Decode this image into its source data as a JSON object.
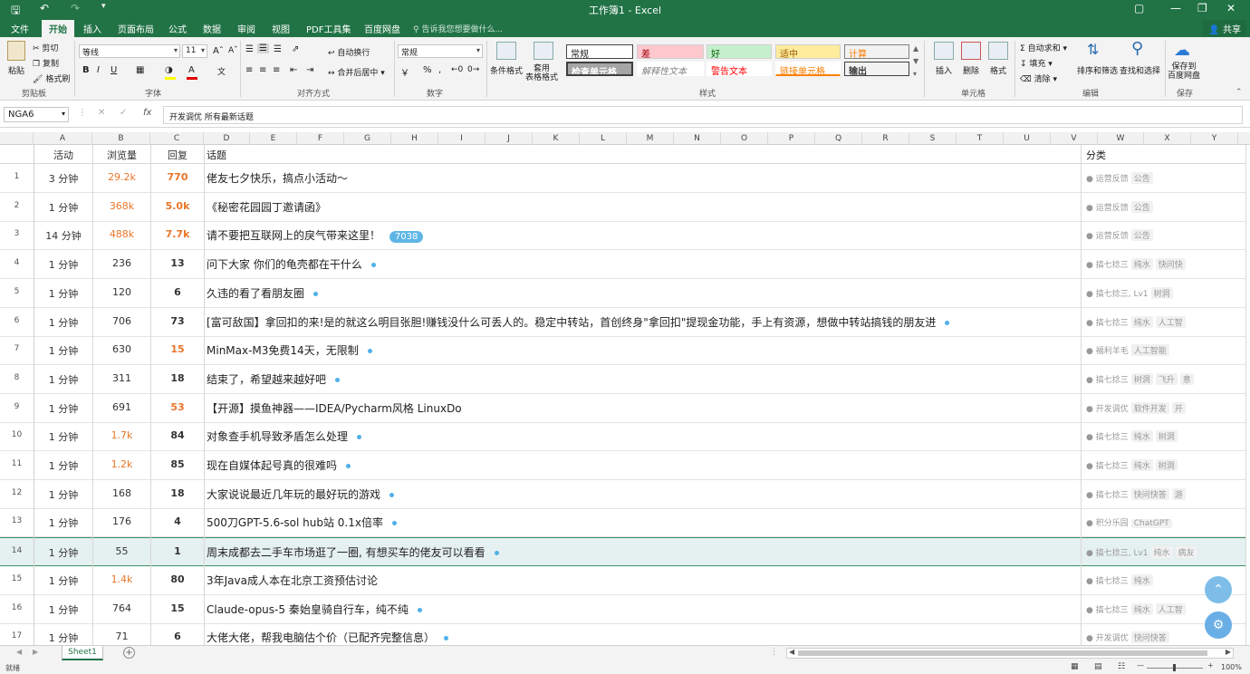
{
  "window": {
    "title": "工作簿1 - Excel"
  },
  "tabs": [
    "文件",
    "开始",
    "插入",
    "页面布局",
    "公式",
    "数据",
    "审阅",
    "视图",
    "PDF工具集",
    "百度网盘"
  ],
  "active_tab": "开始",
  "tell_me": "告诉我您想要做什么...",
  "share": "共享",
  "ribbon": {
    "clipboard": {
      "paste": "粘贴",
      "cut": "剪切",
      "copy": "复制",
      "format_painter": "格式刷",
      "label": "剪贴板"
    },
    "font": {
      "name": "等线",
      "size": "11",
      "label": "字体"
    },
    "alignment": {
      "wrap": "自动换行",
      "merge": "合并后居中",
      "label": "对齐方式"
    },
    "number": {
      "format": "常规",
      "label": "数字"
    },
    "styles": {
      "cond_format": "条件格式",
      "table_format": "套用\n表格格式",
      "label": "样式",
      "boxes": [
        "常规",
        "差",
        "好",
        "适中",
        "计算",
        "检查单元格",
        "解释性文本",
        "警告文本",
        "链接单元格",
        "输出"
      ]
    },
    "cells": {
      "insert": "插入",
      "delete": "删除",
      "format": "格式",
      "label": "单元格"
    },
    "editing": {
      "autosum": "自动求和",
      "fill": "填充",
      "clear": "清除",
      "sort": "排序和筛选",
      "find": "查找和选择",
      "label": "编辑"
    },
    "save": {
      "button": "保存到\n百度网盘",
      "label": "保存"
    }
  },
  "formula_bar": {
    "name_box": "NGA6",
    "fx": "fx",
    "content": "开发调优    所有最新话题"
  },
  "columns": [
    "A",
    "B",
    "C",
    "D",
    "E",
    "F",
    "G",
    "H",
    "I",
    "J",
    "K",
    "L",
    "M",
    "N",
    "O",
    "P",
    "Q",
    "R",
    "S",
    "T",
    "U",
    "V",
    "W",
    "X",
    "Y",
    "Z"
  ],
  "header_row": {
    "activity": "活动",
    "views": "浏览量",
    "replies": "回复",
    "topic": "话题",
    "category": "分类"
  },
  "rows": [
    {
      "n": "1",
      "activity": "3 分钟",
      "views": "29.2k",
      "replies": "770",
      "topic": "佬友七夕快乐，搞点小活动～",
      "badge": "",
      "category": "运营反馈",
      "tags": [
        "公告"
      ],
      "hot_v": true,
      "hot_r": true,
      "dot": false
    },
    {
      "n": "2",
      "activity": "1 分钟",
      "views": "368k",
      "replies": "5.0k",
      "topic": "《秘密花园园丁邀请函》",
      "badge": "",
      "category": "运营反馈",
      "tags": [
        "公告"
      ],
      "hot_v": true,
      "hot_r": true,
      "dot": false
    },
    {
      "n": "3",
      "activity": "14 分钟",
      "views": "488k",
      "replies": "7.7k",
      "topic": "请不要把互联网上的戾气带来这里！",
      "badge": "7038",
      "category": "运营反馈",
      "tags": [
        "公告"
      ],
      "hot_v": true,
      "hot_r": true,
      "dot": false
    },
    {
      "n": "4",
      "activity": "1 分钟",
      "views": "236",
      "replies": "13",
      "topic": "问下大家 你们的龟壳都在干什么",
      "badge": "",
      "category": "搞七捻三",
      "tags": [
        "纯水",
        "快问快"
      ],
      "hot_v": false,
      "hot_r": false,
      "dot": true
    },
    {
      "n": "5",
      "activity": "1 分钟",
      "views": "120",
      "replies": "6",
      "topic": "久违的看了看朋友圈",
      "badge": "",
      "category": "搞七捻三, Lv1",
      "tags": [
        "树洞"
      ],
      "hot_v": false,
      "hot_r": false,
      "dot": true
    },
    {
      "n": "6",
      "activity": "1 分钟",
      "views": "706",
      "replies": "73",
      "topic": "[富可敌国】拿回扣的来!是的就这么明目张胆!赚钱没什么可丢人的。稳定中转站，首创终身\"拿回扣\"提现金功能，手上有资源，想做中转站搞钱的朋友进",
      "badge": "",
      "category": "搞七捻三",
      "tags": [
        "纯水",
        "人工智"
      ],
      "hot_v": false,
      "hot_r": false,
      "dot": true
    },
    {
      "n": "7",
      "activity": "1 分钟",
      "views": "630",
      "replies": "15",
      "topic": "MinMax-M3免费14天，无限制",
      "badge": "",
      "category": "福利羊毛",
      "tags": [
        "人工智能"
      ],
      "hot_v": false,
      "hot_r": true,
      "dot": true
    },
    {
      "n": "8",
      "activity": "1 分钟",
      "views": "311",
      "replies": "18",
      "topic": "结束了，希望越来越好吧",
      "badge": "",
      "category": "搞七捻三",
      "tags": [
        "树洞",
        "飞升",
        "意"
      ],
      "hot_v": false,
      "hot_r": false,
      "dot": true
    },
    {
      "n": "9",
      "activity": "1 分钟",
      "views": "691",
      "replies": "53",
      "topic": "【开源】摸鱼神器——IDEA/Pycharm风格 LinuxDo",
      "badge": "",
      "category": "开发调优",
      "tags": [
        "软件开发",
        "开"
      ],
      "hot_v": false,
      "hot_r": true,
      "dot": false
    },
    {
      "n": "10",
      "activity": "1 分钟",
      "views": "1.7k",
      "replies": "84",
      "topic": "对象查手机导致矛盾怎么处理",
      "badge": "",
      "category": "搞七捻三",
      "tags": [
        "纯水",
        "树洞"
      ],
      "hot_v": true,
      "hot_r": false,
      "dot": true
    },
    {
      "n": "11",
      "activity": "1 分钟",
      "views": "1.2k",
      "replies": "85",
      "topic": "现在自媒体起号真的很难吗",
      "badge": "",
      "category": "搞七捻三",
      "tags": [
        "纯水",
        "树洞"
      ],
      "hot_v": true,
      "hot_r": false,
      "dot": true
    },
    {
      "n": "12",
      "activity": "1 分钟",
      "views": "168",
      "replies": "18",
      "topic": "大家说说最近几年玩的最好玩的游戏",
      "badge": "",
      "category": "搞七捻三",
      "tags": [
        "快问快答",
        "游"
      ],
      "hot_v": false,
      "hot_r": false,
      "dot": true
    },
    {
      "n": "13",
      "activity": "1 分钟",
      "views": "176",
      "replies": "4",
      "topic": "500刀GPT-5.6-sol hub站 0.1x倍率",
      "badge": "",
      "category": "积分乐园",
      "tags": [
        "ChatGPT"
      ],
      "hot_v": false,
      "hot_r": false,
      "dot": true
    },
    {
      "n": "14",
      "activity": "1 分钟",
      "views": "55",
      "replies": "1",
      "topic": "周末成都去二手车市场逛了一圈, 有想买车的佬友可以看看",
      "badge": "",
      "category": "搞七捻三, Lv1",
      "tags": [
        "纯水",
        "病友"
      ],
      "hot_v": false,
      "hot_r": false,
      "dot": true
    },
    {
      "n": "15",
      "activity": "1 分钟",
      "views": "1.4k",
      "replies": "80",
      "topic": "3年Java成人本在北京工资预估讨论",
      "badge": "",
      "category": "搞七捻三",
      "tags": [
        "纯水"
      ],
      "hot_v": true,
      "hot_r": false,
      "dot": false
    },
    {
      "n": "16",
      "activity": "1 分钟",
      "views": "764",
      "replies": "15",
      "topic": "Claude-opus-5 秦始皇骑自行车，纯不纯",
      "badge": "",
      "category": "搞七捻三",
      "tags": [
        "纯水",
        "人工智"
      ],
      "hot_v": false,
      "hot_r": false,
      "dot": true
    },
    {
      "n": "17",
      "activity": "1 分钟",
      "views": "71",
      "replies": "6",
      "topic": "大佬大佬，帮我电脑估个价（已配齐完整信息）",
      "badge": "",
      "category": "开发调优",
      "tags": [
        "快问快答"
      ],
      "hot_v": false,
      "hot_r": false,
      "dot": true
    }
  ],
  "sheet_tab": "Sheet1",
  "status": {
    "ready": "就绪",
    "zoom": "100%"
  }
}
